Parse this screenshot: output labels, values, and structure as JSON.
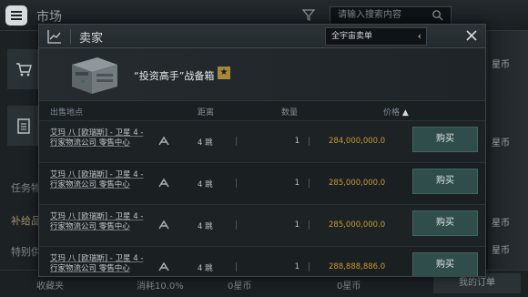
{
  "background": {
    "title": "市场",
    "search_placeholder": "请输入搜索内容",
    "left_labels": [
      "任务物",
      "补给品",
      "特别供"
    ],
    "right_labels": [
      "星币",
      "星币",
      "星币",
      "星币"
    ],
    "bottom": {
      "favorites": "收藏夹",
      "discount": "消耗10.0%",
      "currency_a": "0星币",
      "currency_b": "0星币",
      "my_orders": "我的订单"
    }
  },
  "modal": {
    "title": "卖家",
    "region": "全宇宙卖单",
    "item_name": "“投资高手”战备箱",
    "columns": {
      "location": "出售地点",
      "distance": "距离",
      "quantity": "数量",
      "price": "价格"
    },
    "rows": [
      {
        "location": "艾玛 八 [欧瑞斯] - 卫星 4 - 行家物流公司 零售中心",
        "jumps": "4 跳",
        "quantity": "1",
        "price": "284,000,000.0",
        "action": "购买"
      },
      {
        "location": "艾玛 八 [欧瑞斯] - 卫星 4 - 行家物流公司 零售中心",
        "jumps": "4 跳",
        "quantity": "1",
        "price": "285,000,000.0",
        "action": "购买"
      },
      {
        "location": "艾玛 八 [欧瑞斯] - 卫星 4 - 行家物流公司 零售中心",
        "jumps": "4 跳",
        "quantity": "1",
        "price": "285,000,000.0",
        "action": "购买"
      },
      {
        "location": "艾玛 八 [欧瑞斯] - 卫星 4 - 行家物流公司 零售中心",
        "jumps": "4 跳",
        "quantity": "1",
        "price": "288,888,886.0",
        "action": "购买"
      }
    ]
  },
  "colors": {
    "price": "#c79a33",
    "buy_button": "#2f4d4a",
    "star_badge": "#a8863a"
  },
  "icons": [
    "menu-icon",
    "filter-icon",
    "search-icon",
    "chart-icon",
    "close-icon",
    "chevron-left-icon",
    "star-icon",
    "route-icon",
    "cart-icon",
    "clipboard-icon"
  ]
}
